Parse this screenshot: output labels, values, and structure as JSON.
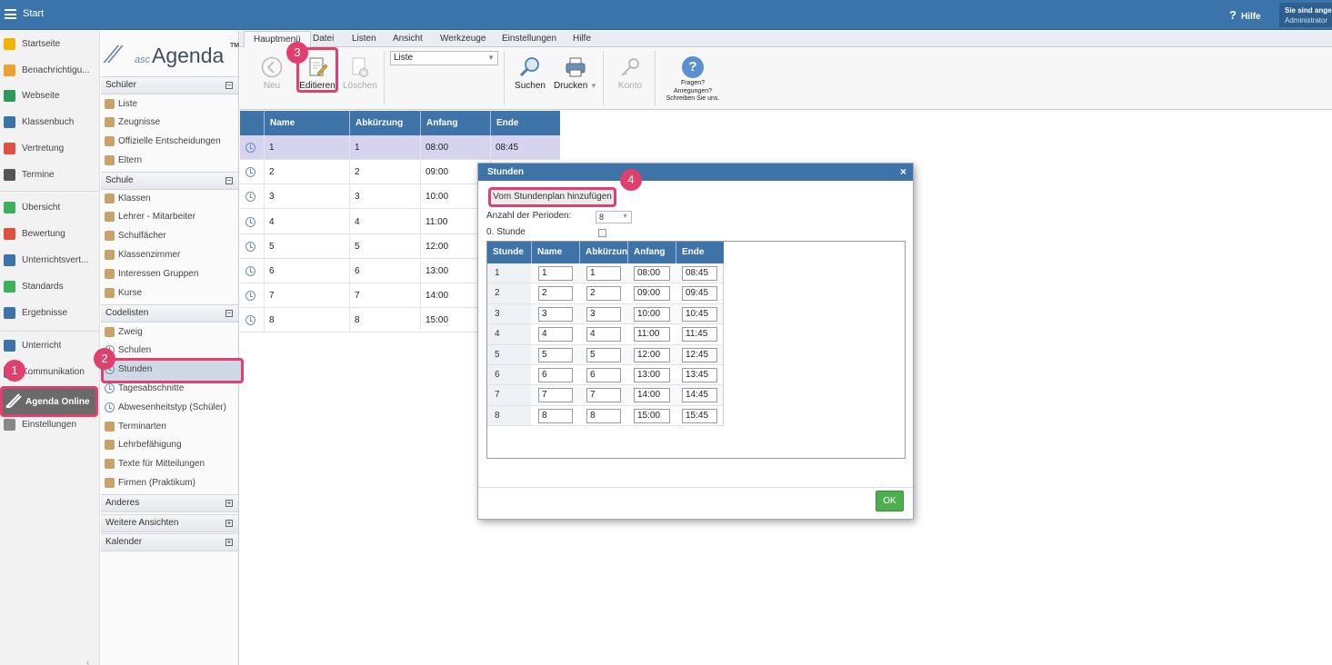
{
  "topbar": {
    "title": "Start",
    "help_label": "Hilfe",
    "user_line1": "Sie sind ange",
    "user_line2": "Administrator"
  },
  "leftnav": {
    "items": [
      {
        "label": "Startseite",
        "icon": "star-icon",
        "color": "#f0b400"
      },
      {
        "label": "Benachrichtigu...",
        "icon": "envelope-icon",
        "color": "#f0a030"
      },
      {
        "label": "Webseite",
        "icon": "home-icon",
        "color": "#2c9a5c"
      },
      {
        "label": "Klassenbuch",
        "icon": "book-icon",
        "color": "#3d73a6"
      },
      {
        "label": "Vertretung",
        "icon": "person-icon",
        "color": "#e05040"
      },
      {
        "label": "Termine",
        "icon": "calendar-icon",
        "color": "#555555"
      },
      {
        "label": "Übersicht",
        "icon": "check-circle-icon",
        "color": "#3cb05a"
      },
      {
        "label": "Bewertung",
        "icon": "rating-icon",
        "color": "#e05040"
      },
      {
        "label": "Unterrichtsvert...",
        "icon": "distribution-icon",
        "color": "#3d73a6"
      },
      {
        "label": "Standards",
        "icon": "shield-icon",
        "color": "#3cb05a"
      },
      {
        "label": "Ergebnisse",
        "icon": "bar-chart-icon",
        "color": "#3d73a6"
      },
      {
        "label": "Unterricht",
        "icon": "school-icon",
        "color": "#3d73a6"
      },
      {
        "label": "Kommunikation",
        "icon": "chat-icon",
        "color": "#3d73a6"
      },
      {
        "label": "Einstellungen",
        "icon": "gear-icon",
        "color": "#888888"
      }
    ],
    "agenda_label": "Agenda Online"
  },
  "logo": {
    "prefix": "asc",
    "name": "Agenda",
    "tm": "TM"
  },
  "panel2": {
    "schueler": {
      "title": "Schüler",
      "items": [
        "Liste",
        "Zeugnisse",
        "Offizielle Entscheidungen",
        "Eltern"
      ]
    },
    "schule": {
      "title": "Schule",
      "items": [
        "Klassen",
        "Lehrer - Mitarbeiter",
        "Schulfächer",
        "Klassenzimmer",
        "Interessen Gruppen",
        "Kurse"
      ]
    },
    "codelisten": {
      "title": "Codelisten",
      "items": [
        "Zweig",
        "Schulen",
        "Stunden",
        "Tagesabschnitte",
        "Abwesenheitstyp (Schüler)",
        "Terminarten",
        "Lehrbefähigung",
        "Texte für Mitteilungen",
        "Firmen (Praktikum)"
      ]
    },
    "anderes": "Anderes",
    "weitere": "Weitere Ansichten",
    "kalender": "Kalender"
  },
  "menubar": [
    "Hauptmenü",
    "Datei",
    "Listen",
    "Ansicht",
    "Werkzeuge",
    "Einstellungen",
    "Hilfe"
  ],
  "toolbar": {
    "neu": "Neu",
    "editieren": "Editieren",
    "loeschen": "Löschen",
    "list_value": "Liste",
    "suchen": "Suchen",
    "drucken": "Drucken",
    "konto": "Konto",
    "fragen_1": "Fragen?",
    "fragen_2": "Anregungen?",
    "fragen_3": "Schreiben Sie uns."
  },
  "grid": {
    "headers": [
      "Name",
      "Abkürzung",
      "Anfang",
      "Ende"
    ],
    "rows": [
      {
        "name": "1",
        "abk": "1",
        "anfang": "08:00",
        "ende": "08:45"
      },
      {
        "name": "2",
        "abk": "2",
        "anfang": "09:00",
        "ende": ""
      },
      {
        "name": "3",
        "abk": "3",
        "anfang": "10:00",
        "ende": ""
      },
      {
        "name": "4",
        "abk": "4",
        "anfang": "11:00",
        "ende": ""
      },
      {
        "name": "5",
        "abk": "5",
        "anfang": "12:00",
        "ende": ""
      },
      {
        "name": "6",
        "abk": "6",
        "anfang": "13:00",
        "ende": ""
      },
      {
        "name": "7",
        "abk": "7",
        "anfang": "14:00",
        "ende": ""
      },
      {
        "name": "8",
        "abk": "8",
        "anfang": "15:00",
        "ende": ""
      }
    ]
  },
  "dialog": {
    "title": "Stunden",
    "add_button": "Vom Stundenplan hinzufügen",
    "perioden_label": "Anzahl der Perioden:",
    "perioden_value": "8",
    "stunde0_label": "0. Stunde",
    "headers": [
      "Stunde",
      "Name",
      "Abkürzun",
      "Anfang",
      "Ende"
    ],
    "rows": [
      {
        "stunde": "1",
        "name": "1",
        "abk": "1",
        "anfang": "08:00",
        "ende": "08:45"
      },
      {
        "stunde": "2",
        "name": "2",
        "abk": "2",
        "anfang": "09:00",
        "ende": "09:45"
      },
      {
        "stunde": "3",
        "name": "3",
        "abk": "3",
        "anfang": "10:00",
        "ende": "10:45"
      },
      {
        "stunde": "4",
        "name": "4",
        "abk": "4",
        "anfang": "11:00",
        "ende": "11:45"
      },
      {
        "stunde": "5",
        "name": "5",
        "abk": "5",
        "anfang": "12:00",
        "ende": "12:45"
      },
      {
        "stunde": "6",
        "name": "6",
        "abk": "6",
        "anfang": "13:00",
        "ende": "13:45"
      },
      {
        "stunde": "7",
        "name": "7",
        "abk": "7",
        "anfang": "14:00",
        "ende": "14:45"
      },
      {
        "stunde": "8",
        "name": "8",
        "abk": "8",
        "anfang": "15:00",
        "ende": "15:45"
      }
    ],
    "ok": "OK"
  },
  "badges": [
    "1",
    "2",
    "3",
    "4"
  ]
}
